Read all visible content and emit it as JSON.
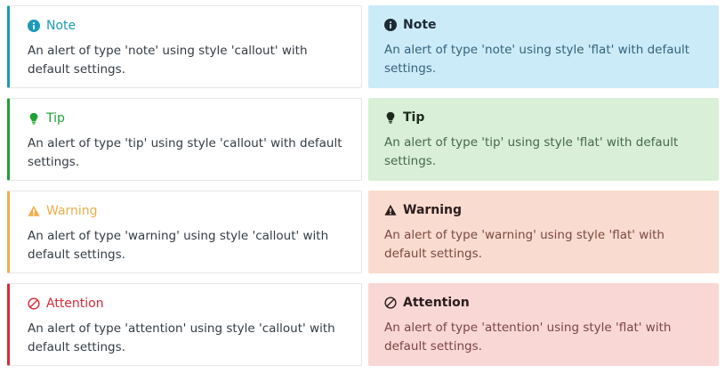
{
  "colors": {
    "note": "#1a9bb7",
    "tip": "#1ea236",
    "warning": "#f0ae4b",
    "attention": "#d72a35",
    "flat_note_bg": "#ccebf9",
    "flat_tip_bg": "#d9efd7",
    "flat_warning_bg": "#fadbd0",
    "flat_attention_bg": "#f9d7d5"
  },
  "alerts": {
    "callout": [
      {
        "type": "note",
        "icon": "info-icon",
        "title": "Note",
        "body": "An alert of type 'note' using style 'callout' with default settings."
      },
      {
        "type": "tip",
        "icon": "lightbulb-icon",
        "title": "Tip",
        "body": "An alert of type 'tip' using style 'callout' with default settings."
      },
      {
        "type": "warning",
        "icon": "warning-triangle-icon",
        "title": "Warning",
        "body": "An alert of type 'warning' using style 'callout' with default settings."
      },
      {
        "type": "attention",
        "icon": "ban-icon",
        "title": "Attention",
        "body": "An alert of type 'attention' using style 'callout' with default settings."
      }
    ],
    "flat": [
      {
        "type": "note",
        "icon": "info-icon",
        "title": "Note",
        "body": "An alert of type 'note' using style 'flat' with default settings."
      },
      {
        "type": "tip",
        "icon": "lightbulb-icon",
        "title": "Tip",
        "body": "An alert of type 'tip' using style 'flat' with default settings."
      },
      {
        "type": "warning",
        "icon": "warning-triangle-icon",
        "title": "Warning",
        "body": "An alert of type 'warning' using style 'flat' with default settings."
      },
      {
        "type": "attention",
        "icon": "ban-icon",
        "title": "Attention",
        "body": "An alert of type 'attention' using style 'flat' with default settings."
      }
    ]
  }
}
